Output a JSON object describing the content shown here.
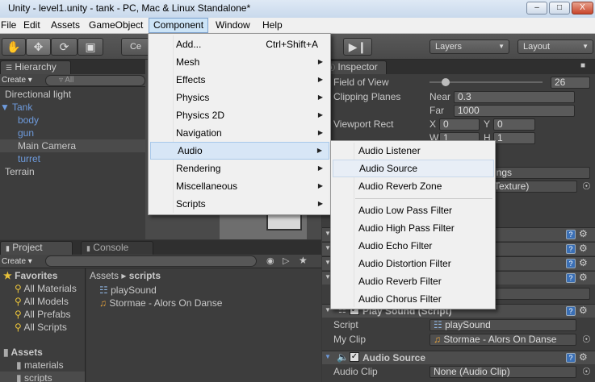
{
  "window": {
    "title": "Unity - level1.unity - tank - PC, Mac & Linux Standalone*",
    "min": "–",
    "max": "□",
    "close": "X"
  },
  "menubar": [
    "File",
    "Edit",
    "Assets",
    "GameObject",
    "Component",
    "Window",
    "Help"
  ],
  "toolbar": {
    "tools": [
      "hand",
      "move",
      "rotate",
      "scale"
    ],
    "center_label": "Ce",
    "layers_label": "Layers",
    "layout_label": "Layout"
  },
  "hierarchy": {
    "tab": "Hierarchy",
    "create": "Create ▾",
    "search_placeholder": "▿ All",
    "items": [
      {
        "label": "Directional light",
        "indent": 0,
        "color": "normal"
      },
      {
        "label": "▼ Tank",
        "indent": 0,
        "color": "blue"
      },
      {
        "label": "body",
        "indent": 1,
        "color": "blue"
      },
      {
        "label": "gun",
        "indent": 1,
        "color": "blue"
      },
      {
        "label": "Main Camera",
        "indent": 1,
        "color": "normal",
        "selected": true
      },
      {
        "label": "turret",
        "indent": 1,
        "color": "blue"
      },
      {
        "label": "Terrain",
        "indent": 0,
        "color": "normal"
      }
    ]
  },
  "project": {
    "tab": "Project",
    "console_tab": "Console",
    "create": "Create ▾",
    "favorites_label": "Favorites",
    "favorites": [
      "All Materials",
      "All Models",
      "All Prefabs",
      "All Scripts"
    ],
    "assets_label": "Assets",
    "folders": [
      "materials",
      "scripts"
    ],
    "breadcrumb_root": "Assets ▸",
    "breadcrumb_current": "scripts",
    "files": [
      "playSound",
      "Stormae - Alors On Danse"
    ]
  },
  "inspector": {
    "tab": "Inspector",
    "field_of_view_label": "Field of View",
    "field_of_view_value": "26",
    "clipping_label": "Clipping Planes",
    "near_label": "Near",
    "near_value": "0.3",
    "far_label": "Far",
    "far_value": "1000",
    "viewport_label": "Viewport Rect",
    "x_label": "X",
    "x_value": "0",
    "y_label": "Y",
    "y_value": "0",
    "w_label": "W",
    "w_value": "1",
    "h_label": "H",
    "h_value": "1",
    "partial_dropdown": "ings",
    "partial_texture": "Texture)",
    "play_sound_header": "Play Sound (Script)",
    "script_label": "Script",
    "script_value": "playSound",
    "myclip_label": "My Clip",
    "myclip_value": "Stormae - Alors On Danse",
    "audio_source_header": "Audio Source",
    "audioclip_label": "Audio Clip",
    "audioclip_value": "None (Audio Clip)"
  },
  "component_menu": [
    {
      "label": "Add...",
      "shortcut": "Ctrl+Shift+A",
      "arrow": false
    },
    {
      "label": "Mesh",
      "arrow": true
    },
    {
      "label": "Effects",
      "arrow": true
    },
    {
      "label": "Physics",
      "arrow": true
    },
    {
      "label": "Physics 2D",
      "arrow": true
    },
    {
      "label": "Navigation",
      "arrow": true
    },
    {
      "label": "Audio",
      "arrow": true,
      "highlighted": true
    },
    {
      "label": "Rendering",
      "arrow": true
    },
    {
      "label": "Miscellaneous",
      "arrow": true
    },
    {
      "label": "Scripts",
      "arrow": true
    }
  ],
  "audio_menu": {
    "group1": [
      "Audio Listener",
      "Audio Source",
      "Audio Reverb Zone"
    ],
    "group2": [
      "Audio Low Pass Filter",
      "Audio High Pass Filter",
      "Audio Echo Filter",
      "Audio Distortion Filter",
      "Audio Reverb Filter",
      "Audio Chorus Filter"
    ],
    "hovered": "Audio Source"
  }
}
